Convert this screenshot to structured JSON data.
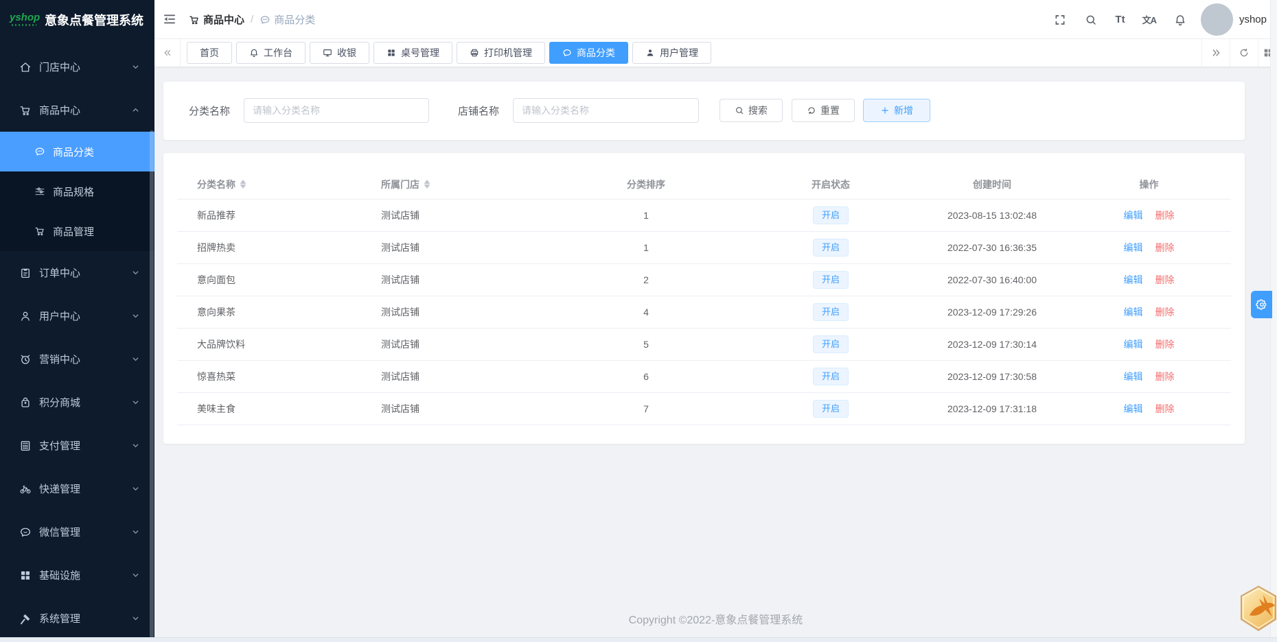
{
  "app": {
    "logo_text": "yshop",
    "title": "意象点餐管理系统"
  },
  "header": {
    "breadcrumb": {
      "level1": "商品中心",
      "separator": "/",
      "level2": "商品分类"
    },
    "font_icon_label": "Tt",
    "translate_icon_label": "文A",
    "username": "yshop"
  },
  "tabs": {
    "items": [
      {
        "label": "首页"
      },
      {
        "label": "工作台"
      },
      {
        "label": "收银"
      },
      {
        "label": "桌号管理"
      },
      {
        "label": "打印机管理"
      },
      {
        "label": "商品分类",
        "active": true
      },
      {
        "label": "用户管理"
      }
    ]
  },
  "sidebar": {
    "items": [
      {
        "label": "门店中心"
      },
      {
        "label": "商品中心",
        "children": [
          {
            "label": "商品分类",
            "active": true
          },
          {
            "label": "商品规格"
          },
          {
            "label": "商品管理"
          }
        ]
      },
      {
        "label": "订单中心"
      },
      {
        "label": "用户中心"
      },
      {
        "label": "营销中心"
      },
      {
        "label": "积分商城"
      },
      {
        "label": "支付管理"
      },
      {
        "label": "快递管理"
      },
      {
        "label": "微信管理"
      },
      {
        "label": "基础设施"
      },
      {
        "label": "系统管理"
      }
    ]
  },
  "filters": {
    "category_label": "分类名称",
    "category_placeholder": "请输入分类名称",
    "shop_label": "店铺名称",
    "shop_placeholder": "请输入分类名称",
    "search_button": "搜索",
    "reset_button": "重置",
    "add_button": "新增"
  },
  "table": {
    "headers": [
      "分类名称",
      "所属门店",
      "分类排序",
      "开启状态",
      "创建时间",
      "操作"
    ],
    "actions": {
      "edit": "编辑",
      "delete": "删除"
    },
    "rows": [
      {
        "name": "新品推荐",
        "shop": "测试店铺",
        "sort": "1",
        "status": "开启",
        "created": "2023-08-15 13:02:48"
      },
      {
        "name": "招牌热卖",
        "shop": "测试店铺",
        "sort": "1",
        "status": "开启",
        "created": "2022-07-30 16:36:35"
      },
      {
        "name": "意向面包",
        "shop": "测试店铺",
        "sort": "2",
        "status": "开启",
        "created": "2022-07-30 16:40:00"
      },
      {
        "name": "意向果茶",
        "shop": "测试店铺",
        "sort": "4",
        "status": "开启",
        "created": "2023-12-09 17:29:26"
      },
      {
        "name": "大品牌饮料",
        "shop": "测试店铺",
        "sort": "5",
        "status": "开启",
        "created": "2023-12-09 17:30:14"
      },
      {
        "name": "惊喜热菜",
        "shop": "测试店铺",
        "sort": "6",
        "status": "开启",
        "created": "2023-12-09 17:30:58"
      },
      {
        "name": "美味主食",
        "shop": "测试店铺",
        "sort": "7",
        "status": "开启",
        "created": "2023-12-09 17:31:18"
      }
    ]
  },
  "footer": {
    "copyright": "Copyright ©2022-意象点餐管理系统"
  },
  "colors": {
    "accent": "#409eff",
    "danger": "#f56c6c",
    "sidebar_bg": "#0d1b2d",
    "submenu_bg": "#091524",
    "active_menu": "#4a9eff",
    "content_bg": "#f0f2f5",
    "tag_bg": "#ecf5ff",
    "tag_border": "#d9ecff"
  }
}
